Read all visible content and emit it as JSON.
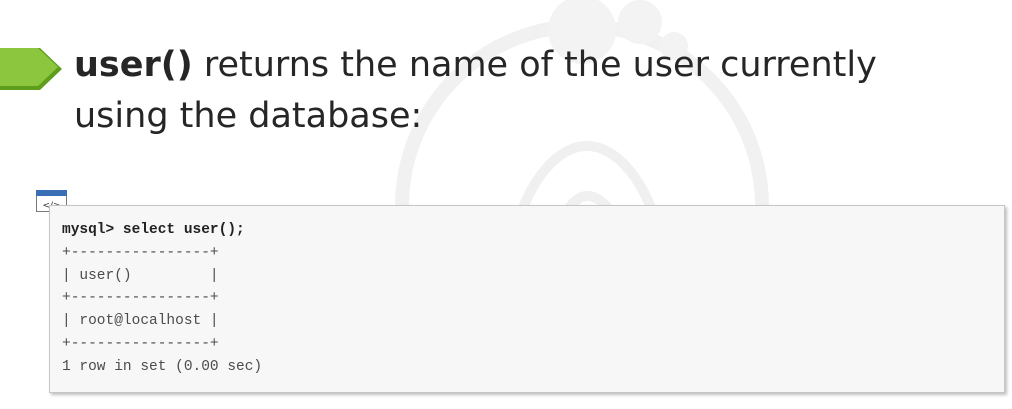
{
  "colors": {
    "accent": "#8cc63f",
    "accent_dark": "#5f9e1d",
    "text": "#262626",
    "code_bg": "#f7f7f7",
    "icon_blue": "#3a6fb6"
  },
  "slide": {
    "function_name": "user()",
    "description": " returns the name of the user currently using the database:"
  },
  "code": {
    "icon_label": "</>",
    "lines": [
      "mysql> select user();",
      "+----------------+",
      "| user()         |",
      "+----------------+",
      "| root@localhost |",
      "+----------------+",
      "1 row in set (0.00 sec)"
    ]
  }
}
